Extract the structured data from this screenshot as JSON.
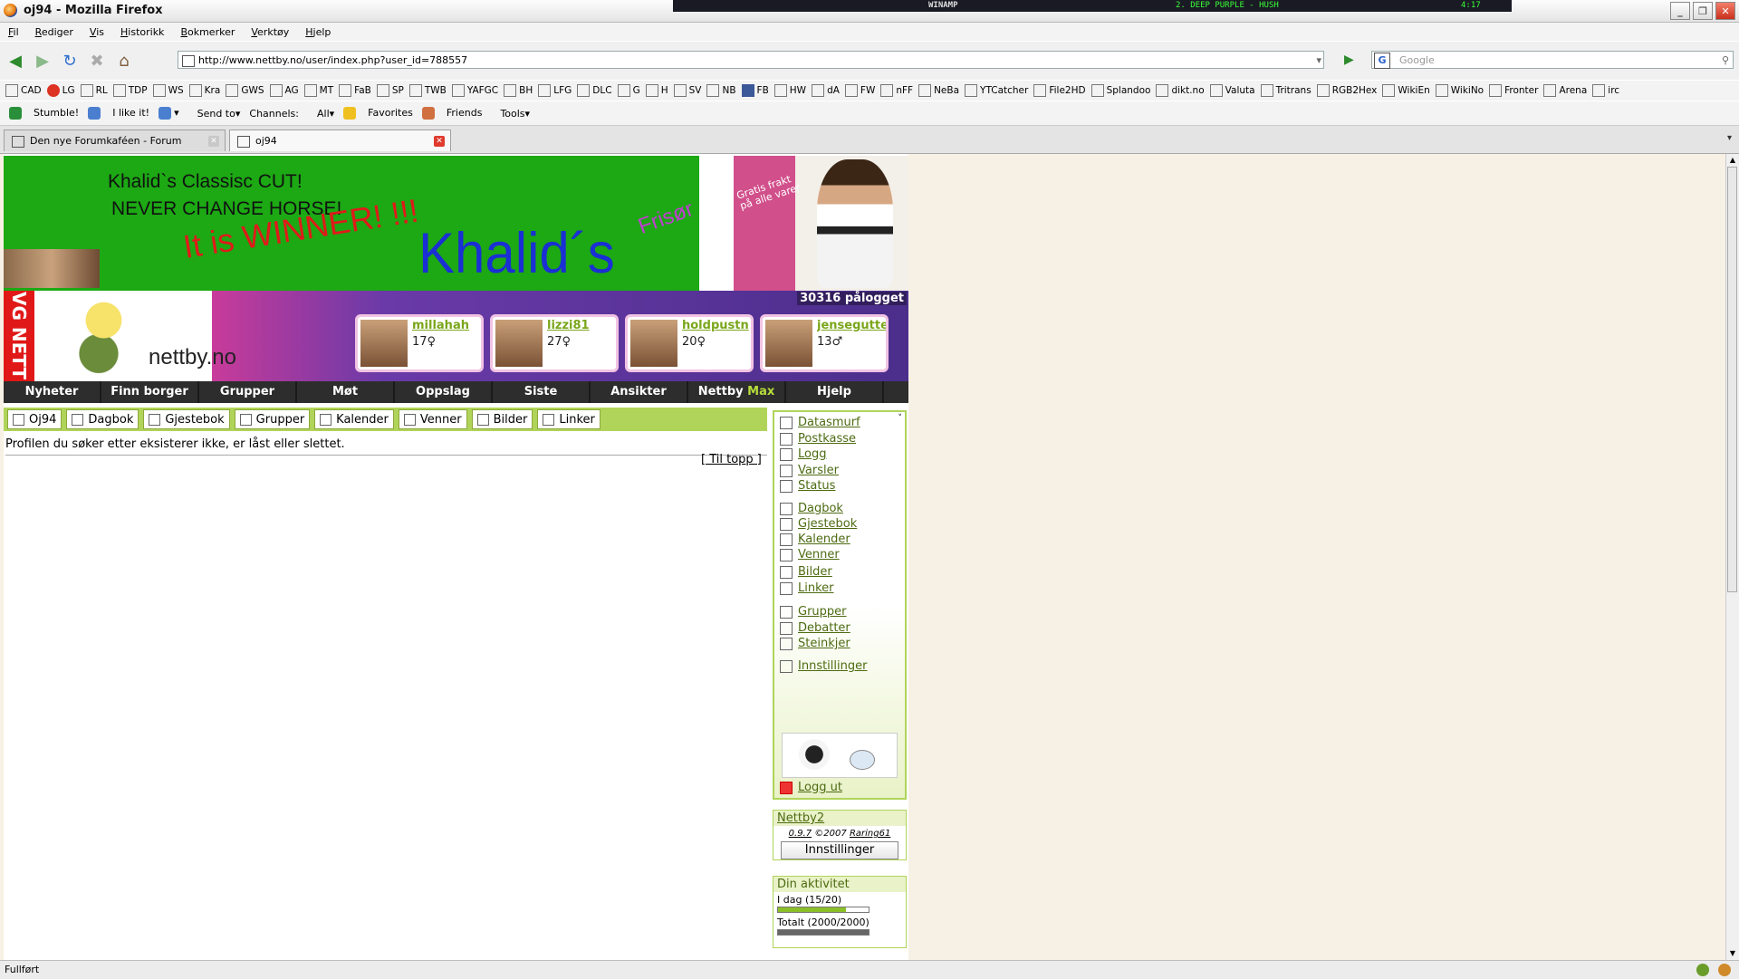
{
  "window": {
    "title": "oj94 - Mozilla Firefox"
  },
  "winamp": {
    "logo": "WINAMP",
    "song": "2. DEEP PURPLE - HUSH",
    "time": "4:17"
  },
  "menu": [
    "Fil",
    "Rediger",
    "Vis",
    "Historikk",
    "Bokmerker",
    "Verktøy",
    "Hjelp"
  ],
  "address": {
    "url": "http://www.nettby.no/user/index.php?user_id=788557"
  },
  "search": {
    "placeholder": "Google"
  },
  "bookmarks": [
    "CAD",
    "LG",
    "RL",
    "TDP",
    "WS",
    "Kra",
    "GWS",
    "AG",
    "MT",
    "FaB",
    "SP",
    "TWB",
    "YAFGC",
    "BH",
    "LFG",
    "DLC",
    "G",
    "H",
    "SV",
    "NB",
    "FB",
    "HW",
    "dA",
    "FW",
    "nFF",
    "NeBa",
    "YTCatcher",
    "File2HD",
    "Splandoo",
    "dikt.no",
    "Valuta",
    "Tritrans",
    "RGB2Hex",
    "WikiEn",
    "WikiNo",
    "Fronter",
    "Arena",
    "irc"
  ],
  "stumble": {
    "stumble": "Stumble!",
    "like": "I like it!",
    "send": "Send to",
    "channels": "Channels:",
    "all": "All",
    "favorites": "Favorites",
    "friends": "Friends",
    "tools": "Tools"
  },
  "tabs": [
    {
      "label": "Den nye Forumkaféen - Forum"
    },
    {
      "label": "oj94"
    }
  ],
  "ad": {
    "line1": "Khalid`s Classisc CUT!",
    "line2": "NEVER CHANGE HORSE!",
    "winner": "It is WINNER! !!!",
    "brand": "Khalid´s",
    "frisor": "Frisør",
    "frakt": "Gratis frakt\npå alle varer"
  },
  "banner": {
    "vg": "VG NETT",
    "logo": "nettby.no",
    "online": "30316 pålogget"
  },
  "users": [
    {
      "name": "millahah",
      "age": "17♀"
    },
    {
      "name": "lizzi81",
      "age": "27♀"
    },
    {
      "name": "holdpustn",
      "age": "20♀"
    },
    {
      "name": "jensegutte",
      "age": "13♂"
    }
  ],
  "mainnav": [
    "Nyheter",
    "Finn borger",
    "Grupper",
    "Møt",
    "Oppslag",
    "Siste",
    "Ansikter",
    "Nettby",
    "Hjelp"
  ],
  "mainnav_max": "Max",
  "subtabs": [
    "Oj94",
    "Dagbok",
    "Gjestebok",
    "Grupper",
    "Kalender",
    "Venner",
    "Bilder",
    "Linker"
  ],
  "message": "Profilen du søker etter eksisterer ikke, er låst eller slettet.",
  "totop": "[ Til topp ]",
  "side": [
    "Datasmurf",
    "Postkasse",
    "Logg",
    "Varsler",
    "Status",
    "Dagbok",
    "Gjestebok",
    "Kalender",
    "Venner",
    "Bilder",
    "Linker",
    "Grupper",
    "Debatter",
    "Steinkjer",
    "Innstillinger"
  ],
  "logout": "Logg ut",
  "nettby2": {
    "title": "Nettby2",
    "version": "0.9.7",
    "copy": "©2007",
    "author": "Raring61",
    "button": "Innstillinger"
  },
  "activity": {
    "title": "Din aktivitet",
    "today": "I dag (15/20)",
    "today_ratio": 0.75,
    "total": "Totalt (2000/2000)",
    "total_ratio": 1.0
  },
  "status": {
    "text": "Fullført"
  }
}
